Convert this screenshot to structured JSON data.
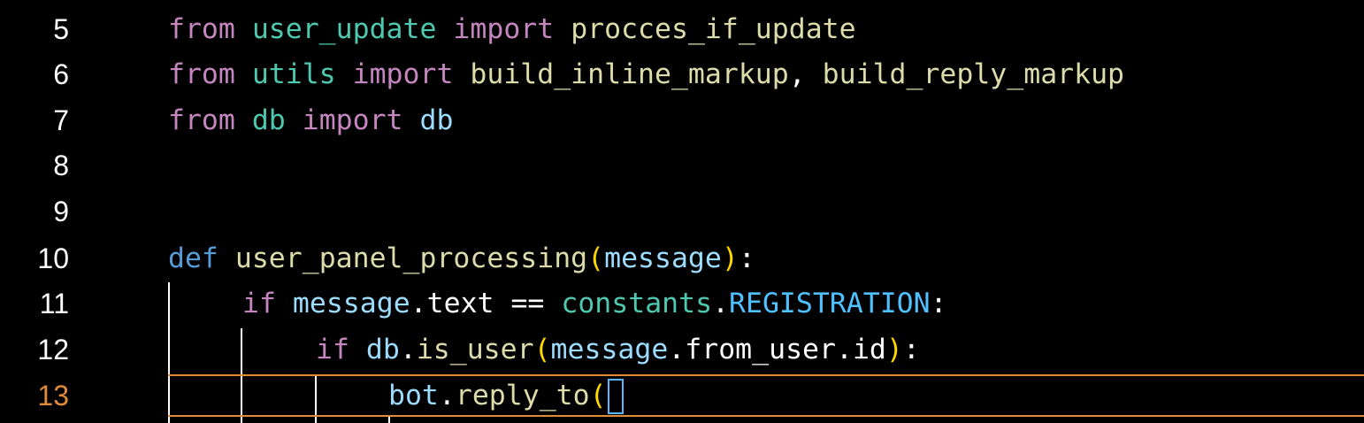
{
  "editor": {
    "active_line": "13",
    "colors": {
      "background": "#000000",
      "keyword_flow": "#c586c0",
      "keyword_def": "#569cd6",
      "module": "#4ec9b0",
      "function": "#dcdcaa",
      "variable": "#9cdcfe",
      "constant": "#4fc1ff",
      "bracket": "#ffd700",
      "active_line_accent": "#e08a3c",
      "bracket_match_border": "#56b6ff"
    },
    "lines": [
      {
        "number": "5",
        "tokens": [
          "from",
          "user_update",
          "import",
          "procces_if_update"
        ]
      },
      {
        "number": "6",
        "tokens": [
          "from",
          "utils",
          "import",
          "build_inline_markup",
          ",",
          "build_reply_markup"
        ]
      },
      {
        "number": "7",
        "tokens": [
          "from",
          "db",
          "import",
          "db"
        ]
      },
      {
        "number": "8",
        "tokens": []
      },
      {
        "number": "9",
        "tokens": []
      },
      {
        "number": "10",
        "tokens": [
          "def",
          "user_panel_processing",
          "(",
          "message",
          ")",
          ":"
        ]
      },
      {
        "number": "11",
        "tokens": [
          "if",
          "message",
          ".",
          "text",
          "==",
          "constants",
          ".",
          "REGISTRATION",
          ":"
        ]
      },
      {
        "number": "12",
        "tokens": [
          "if",
          "db",
          ".",
          "is_user",
          "(",
          "message",
          ".",
          "from_user",
          ".",
          "id",
          ")",
          ":"
        ]
      },
      {
        "number": "13",
        "tokens": [
          "bot",
          ".",
          "reply_to",
          "("
        ]
      }
    ]
  }
}
